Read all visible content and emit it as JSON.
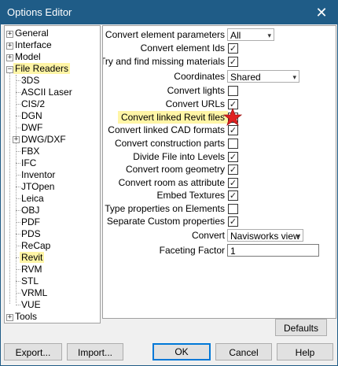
{
  "window": {
    "title": "Options Editor",
    "close_glyph": "✕"
  },
  "tree": {
    "top_items": [
      {
        "label": "General",
        "expander": "+"
      },
      {
        "label": "Interface",
        "expander": "+"
      },
      {
        "label": "Model",
        "expander": "+"
      },
      {
        "label": "File Readers",
        "expander": "−"
      }
    ],
    "file_readers": [
      {
        "label": "3DS"
      },
      {
        "label": "ASCII Laser"
      },
      {
        "label": "CIS/2"
      },
      {
        "label": "DGN"
      },
      {
        "label": "DWF"
      },
      {
        "label": "DWG/DXF",
        "expander": "+"
      },
      {
        "label": "FBX"
      },
      {
        "label": "IFC"
      },
      {
        "label": "Inventor"
      },
      {
        "label": "JTOpen"
      },
      {
        "label": "Leica"
      },
      {
        "label": "OBJ"
      },
      {
        "label": "PDF"
      },
      {
        "label": "PDS"
      },
      {
        "label": "ReCap"
      },
      {
        "label": "Revit"
      },
      {
        "label": "RVM"
      },
      {
        "label": "STL"
      },
      {
        "label": "VRML"
      },
      {
        "label": "VUE"
      }
    ],
    "bottom_items": [
      {
        "label": "Tools",
        "expander": "+"
      }
    ]
  },
  "properties": {
    "convert_element_parameters": {
      "label": "Convert element parameters",
      "value": "All"
    },
    "convert_element_ids": {
      "label": "Convert element Ids",
      "checked": true
    },
    "try_find_missing_materials": {
      "label": "Try and find missing materials",
      "checked": true
    },
    "coordinates": {
      "label": "Coordinates",
      "value": "Shared"
    },
    "convert_lights": {
      "label": "Convert lights",
      "checked": false
    },
    "convert_urls": {
      "label": "Convert URLs",
      "checked": true
    },
    "convert_linked_revit_files": {
      "label": "Convert linked Revit files",
      "checked": true
    },
    "convert_linked_cad_formats": {
      "label": "Convert linked CAD formats",
      "checked": true
    },
    "convert_construction_parts": {
      "label": "Convert construction parts",
      "checked": false
    },
    "divide_file_into_levels": {
      "label": "Divide File into Levels",
      "checked": true
    },
    "convert_room_geometry": {
      "label": "Convert room geometry",
      "checked": true
    },
    "convert_room_as_attribute": {
      "label": "Convert room as attribute",
      "checked": true
    },
    "embed_textures": {
      "label": "Embed Textures",
      "checked": true
    },
    "type_properties_on_elements": {
      "label": "Type properties on Elements",
      "checked": false
    },
    "separate_custom_properties": {
      "label": "Separate Custom properties",
      "checked": true
    },
    "convert": {
      "label": "Convert",
      "value": "Navisworks view"
    },
    "faceting_factor": {
      "label": "Faceting Factor",
      "value": "1"
    },
    "check_glyph": "✓",
    "dropdown_glyph": "▾",
    "star_color": "#e02020"
  },
  "buttons": {
    "defaults": "Defaults",
    "export": "Export...",
    "import": "Import...",
    "ok": "OK",
    "cancel": "Cancel",
    "help": "Help"
  },
  "colors": {
    "titlebar": "#1f5c87",
    "highlight": "#fff5a6",
    "primary_border": "#0078d7"
  }
}
